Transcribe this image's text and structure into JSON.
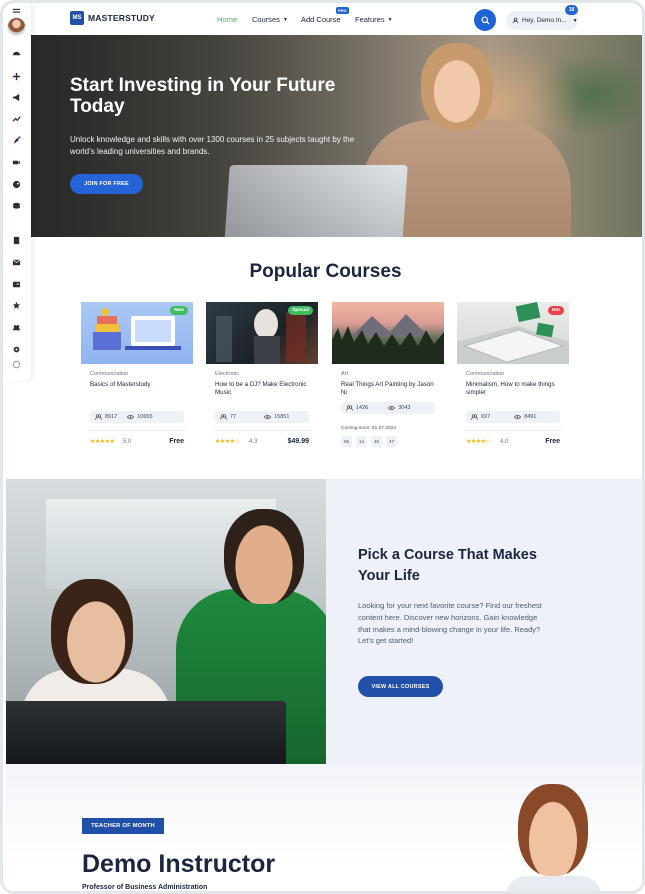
{
  "navbar": {
    "logo_mark": "MS",
    "logo_text": "MASTERSTUDY",
    "links": [
      {
        "label": "Home",
        "active": true
      },
      {
        "label": "Courses",
        "has_caret": true
      },
      {
        "label": "Add Course",
        "badge": "PRO"
      },
      {
        "label": "Features",
        "has_caret": true
      }
    ],
    "user_label": "Hey, Demo In...",
    "notification_count": "18"
  },
  "sidebar": {
    "icons": [
      "avatar",
      "dashboard-icon",
      "plus-icon",
      "megaphone-icon",
      "analytics-icon",
      "rocket-icon",
      "video-icon",
      "palette-icon",
      "layers-icon",
      "book-icon",
      "mail-icon",
      "id-card-icon",
      "star-icon",
      "users-icon",
      "settings-icon",
      "info-icon"
    ]
  },
  "hero": {
    "title": "Start Investing in Your Future Today",
    "subtitle": "Unlock knowledge and skills with over 1300 courses in 25 subjects taught by the world’s leading universities and brands.",
    "button_label": "JOIN FOR FREE"
  },
  "popular": {
    "title": "Popular Courses",
    "courses": [
      {
        "category": "Communication",
        "title": "Basics of Masterstudy",
        "badge": "New",
        "badge_color": "#3dbd5e",
        "students": "8917",
        "views": "10655",
        "rating": "5.0",
        "stars": "★★★★★",
        "price": "Free"
      },
      {
        "category": "Electronic",
        "title": "How to be a DJ? Make Electronic Music",
        "badge": "Special",
        "badge_color": "#3dbd5e",
        "students": "77",
        "views": "15851",
        "rating": "4.3",
        "stars": "★★★★☆",
        "price": "$49.99"
      },
      {
        "category": "Art",
        "title": "Real Things Art Painting by Jason Ni",
        "badge": "",
        "students": "1426",
        "views": "3043",
        "coming_soon": "Coming soon: 01.07.2024",
        "countdown": [
          "06",
          "14",
          "40",
          "47"
        ]
      },
      {
        "category": "Communication",
        "title": "Minimalism, How to make things simpler",
        "badge": "Hot",
        "badge_color": "#e9434b",
        "students": "697",
        "views": "8491",
        "rating": "4.0",
        "stars": "★★★★☆",
        "price": "Free"
      }
    ]
  },
  "pick": {
    "title": "Pick a Course That Makes Your Life",
    "text": "Looking for your next favorite course? Find our freshest content here. Discover new horizons. Gain knowledge that makes a mind-blowing change in your life. Ready? Let’s get started!",
    "button_label": "VIEW ALL COURSES"
  },
  "teacher": {
    "badge": "TEACHER OF MONTH",
    "name": "Demo Instructor",
    "role": "Professor of Business Administration"
  },
  "colors": {
    "primary": "#2150a8",
    "accent_blue": "#2563d6",
    "active_link": "#3dbd5e",
    "star": "#f4b400"
  }
}
